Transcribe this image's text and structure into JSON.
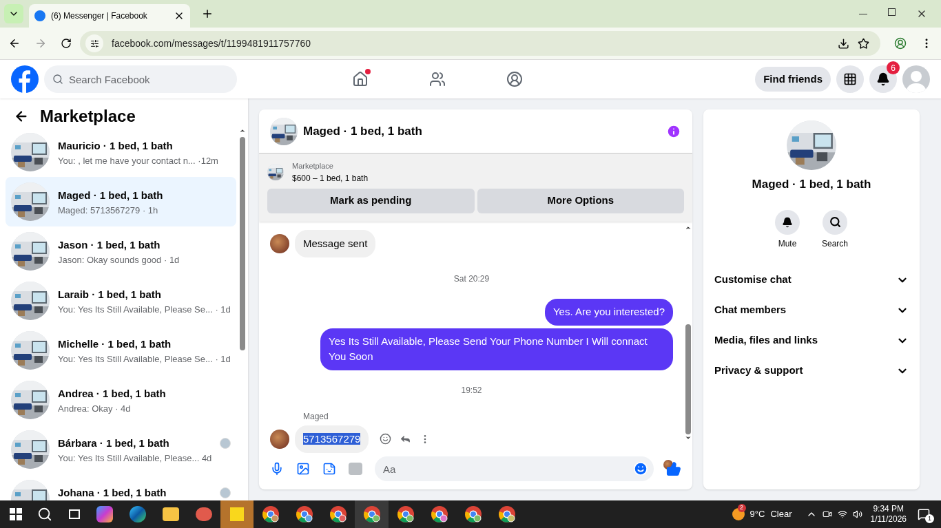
{
  "browser": {
    "tab_title": "(6) Messenger | Facebook",
    "url": "facebook.com/messages/t/1199481911757760"
  },
  "header": {
    "search_placeholder": "Search Facebook",
    "find_friends": "Find friends",
    "notification_count": "6"
  },
  "sidebar": {
    "title": "Marketplace",
    "conversations": [
      {
        "name": "Mauricio · 1 bed, 1 bath",
        "preview": "You: , let me have your contact n...",
        "time": "·12m",
        "selected": false,
        "seen": false
      },
      {
        "name": "Maged · 1 bed, 1 bath",
        "preview": "Maged: 5713567279",
        "time": "· 1h",
        "selected": true,
        "seen": false
      },
      {
        "name": "Jason · 1 bed, 1 bath",
        "preview": "Jason: Okay sounds good",
        "time": "· 1d",
        "selected": false,
        "seen": false
      },
      {
        "name": "Laraib · 1 bed, 1 bath",
        "preview": "You: Yes Its Still Available, Please Se...",
        "time": "· 1d",
        "selected": false,
        "seen": false
      },
      {
        "name": "Michelle · 1 bed, 1 bath",
        "preview": "You: Yes Its Still Available, Please Se...",
        "time": "· 1d",
        "selected": false,
        "seen": false
      },
      {
        "name": "Andrea · 1 bed, 1 bath",
        "preview": "Andrea: Okay",
        "time": "· 4d",
        "selected": false,
        "seen": false
      },
      {
        "name": "Bárbara · 1 bed, 1 bath",
        "preview": "You: Yes Its Still Available, Please...",
        "time": "4d",
        "selected": false,
        "seen": true
      },
      {
        "name": "Johana · 1 bed, 1 bath",
        "selected": false,
        "seen": true
      }
    ]
  },
  "chat": {
    "title": "Maged · 1 bed, 1 bath",
    "listing": {
      "label": "Marketplace",
      "price": "$600 – 1 bed, 1 bath"
    },
    "actions": [
      "Mark as pending",
      "More Options"
    ],
    "messages": [
      {
        "kind": "incoming",
        "text": "Message sent",
        "selected": false
      },
      {
        "kind": "timestamp",
        "text": "Sat 20:29"
      },
      {
        "kind": "outgoing",
        "text": "Yes. Are you interested?"
      },
      {
        "kind": "outgoing",
        "text": "Yes Its Still Available, Please Send Your Phone Number I Will connact You Soon"
      },
      {
        "kind": "timestamp",
        "text": "19:52"
      },
      {
        "kind": "sender",
        "text": "Maged"
      },
      {
        "kind": "incoming",
        "text": "5713567279",
        "selected": true
      }
    ],
    "composer_placeholder": "Aa"
  },
  "info": {
    "name": "Maged · 1 bed, 1 bath",
    "actions": [
      {
        "kind": "mute",
        "label": "Mute"
      },
      {
        "kind": "search",
        "label": "Search"
      }
    ],
    "sections": [
      {
        "label": "Customise chat",
        "expanded": false
      },
      {
        "label": "Chat members",
        "expanded": false
      },
      {
        "label": "Media, files and links",
        "expanded": false
      },
      {
        "label": "Privacy & support",
        "expanded": false
      }
    ]
  },
  "taskbar": {
    "weather_badge": "2",
    "weather": "9°C",
    "condition": "Clear",
    "time": "9:34 PM",
    "date": "1/11/2026",
    "notifications": "1"
  }
}
